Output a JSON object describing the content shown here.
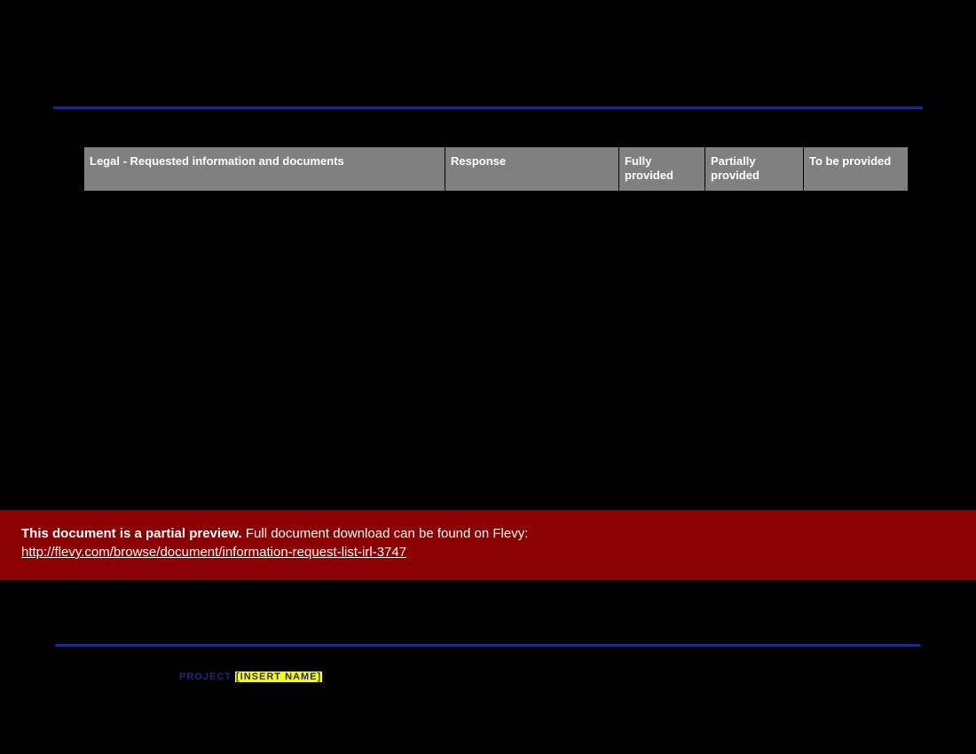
{
  "table": {
    "headers": {
      "col1": "Legal - Requested information and documents",
      "col2": "Response",
      "col3": "Fully provided",
      "col4": "Partially provided",
      "col5": "To be provided"
    }
  },
  "banner": {
    "bold": "This document is a partial preview.",
    "rest": "  Full document download can be found on Flevy:",
    "link_text": "http://flevy.com/browse/document/information-request-list-irl-3747",
    "link_href": "http://flevy.com/browse/document/information-request-list-irl-3747"
  },
  "project": {
    "label": "PROJECT ",
    "placeholder": "[INSERT NAME]"
  }
}
